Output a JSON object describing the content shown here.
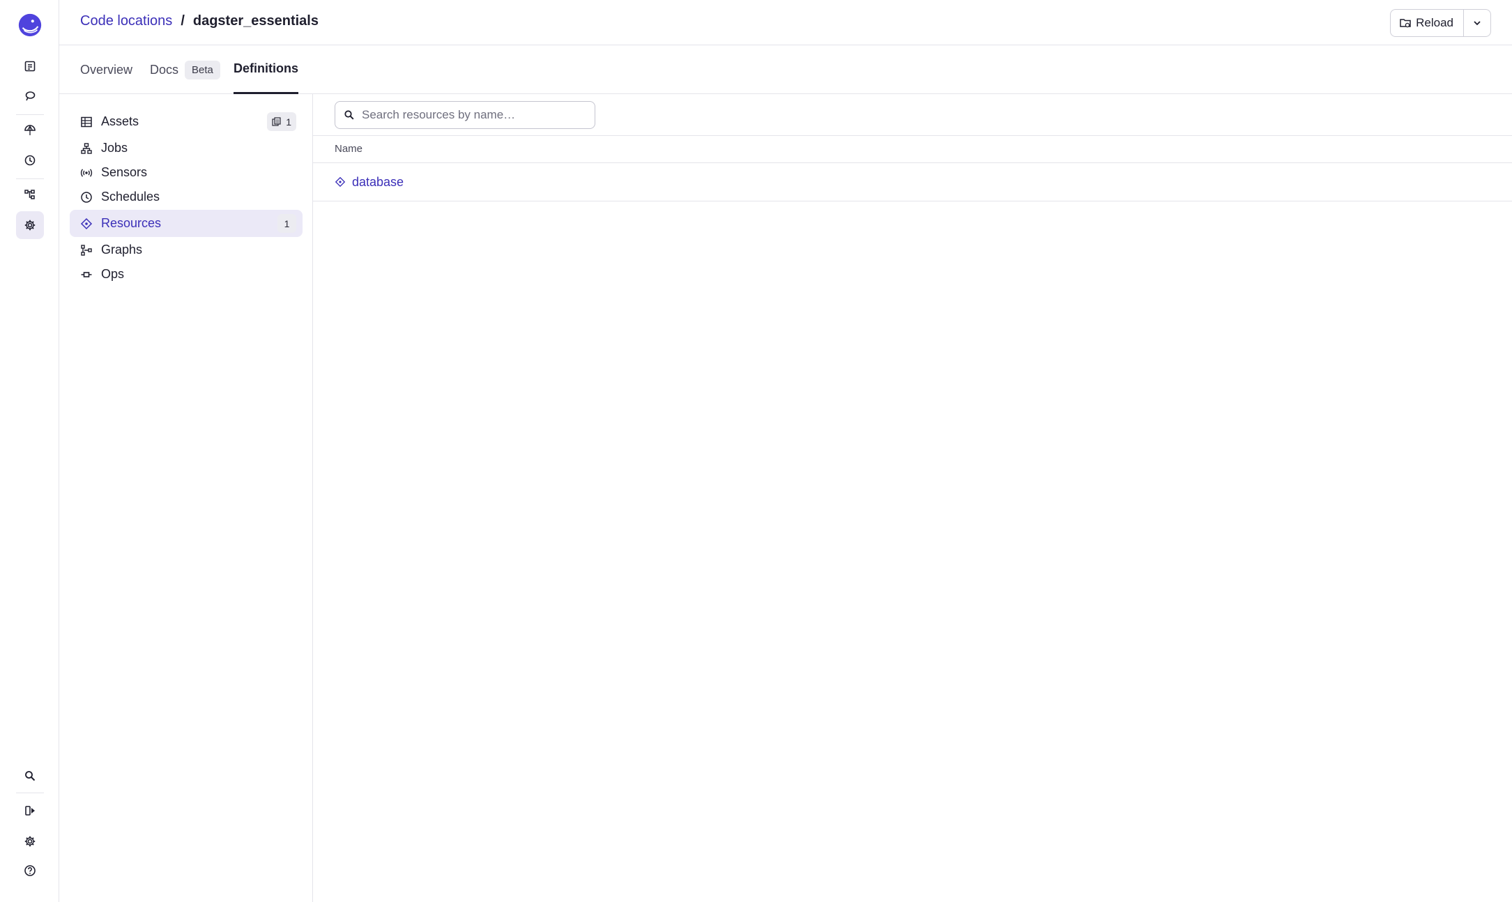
{
  "breadcrumb": {
    "parent": "Code locations",
    "separator": "/",
    "current": "dagster_essentials"
  },
  "header": {
    "reload_label": "Reload"
  },
  "tabs": [
    {
      "label": "Overview"
    },
    {
      "label": "Docs",
      "badge": "Beta"
    },
    {
      "label": "Definitions",
      "active": true
    }
  ],
  "nav": {
    "items": [
      {
        "label": "Assets",
        "icon": "table-icon",
        "count": "1"
      },
      {
        "label": "Jobs",
        "icon": "job-icon"
      },
      {
        "label": "Sensors",
        "icon": "sensor-icon"
      },
      {
        "label": "Schedules",
        "icon": "clock-icon"
      },
      {
        "label": "Resources",
        "icon": "resource-icon",
        "count": "1",
        "active": true
      },
      {
        "label": "Graphs",
        "icon": "graph-icon"
      },
      {
        "label": "Ops",
        "icon": "op-icon"
      }
    ]
  },
  "search": {
    "placeholder": "Search resources by name…",
    "value": ""
  },
  "table": {
    "columns": [
      "Name"
    ],
    "rows": [
      {
        "name": "database"
      }
    ]
  },
  "colors": {
    "accent": "#3b2fb8",
    "active_bg": "#ebe9f7",
    "border": "#e4e4ea"
  }
}
